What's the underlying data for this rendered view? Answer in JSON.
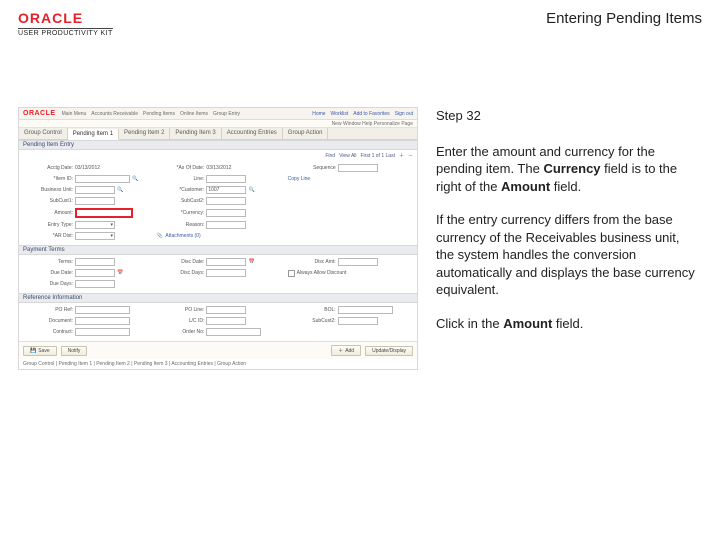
{
  "header": {
    "logo_text": "ORACLE",
    "logo_sub": "USER PRODUCTIVITY KIT",
    "doc_title": "Entering Pending Items"
  },
  "instructions": {
    "step_label": "Step 32",
    "p1a": "Enter the amount and currency for the pending item. The ",
    "p1b": "Currency",
    "p1c": " field is to the right of the ",
    "p1d": "Amount",
    "p1e": " field.",
    "p2": "If the entry currency differs from the base currency of the Receivables business unit, the system handles the conversion automatically and displays the base currency equivalent.",
    "p3a": "Click in the ",
    "p3b": "Amount",
    "p3c": " field."
  },
  "app": {
    "logo": "ORACLE",
    "menu": [
      "Home",
      "Worklist",
      "Add to Favorites",
      "Sign out"
    ],
    "nav": [
      "Main Menu",
      "Accounts Receivable",
      "Pending Items",
      "Online Items",
      "Group Entry"
    ],
    "subnav": "New Window  Help  Personalize Page",
    "tabs": [
      "Group Control",
      "Pending Item 1",
      "Pending Item 2",
      "Pending Item 3",
      "Accounting Entries",
      "Group Action"
    ],
    "active_tab": 1,
    "section1": "Pending Item Entry",
    "toolbar": {
      "find": "Find",
      "viewall": "View All",
      "range": "First 1 of 1 Last"
    },
    "section2": "Payment Terms",
    "section3": "Reference Information",
    "fields": {
      "acctg_date": "Acctg Date:",
      "acctg_date_val": "03/13/2012",
      "from_date": "*As Of Date:",
      "from_date_val": "03/13/2012",
      "sequence": "Sequence",
      "item_id": "*Item ID:",
      "line": "Line:",
      "copy_line": "Copy Line",
      "business_unit": "Business Unit:",
      "customer": "*Customer:",
      "customer_val": "1007",
      "subcust1": "SubCust1:",
      "subcust2": "SubCust2:",
      "amount": "Amount:",
      "currency": "*Currency:",
      "entry_type": "Entry Type:",
      "reason": "Reason:",
      "ar_dist": "*AR Dist:",
      "attachments": "Attachments (0)",
      "terms": "Terms:",
      "disc_date": "Disc Date:",
      "disc_days": "Disc Days:",
      "due_date": "Due Date:",
      "due_days": "Due Days:",
      "disc_amt": "Disc Amt:",
      "allow_disc": "Always Allow Discount",
      "po_ref": "PO Ref:",
      "po_line": "PO Line:",
      "bol": "BOL:",
      "document": "Document:",
      "lc": "L/C ID:",
      "subcust2b": "SubCust2:",
      "contract": "Contract:",
      "so": "Order No:"
    },
    "buttons": {
      "save": "Save",
      "notify": "Notify",
      "add": "Add",
      "update": "Update/Display"
    },
    "crumb": "Group Control | Pending Item 1 | Pending Item 2 | Pending Item 3 | Accounting Entries | Group Action"
  }
}
